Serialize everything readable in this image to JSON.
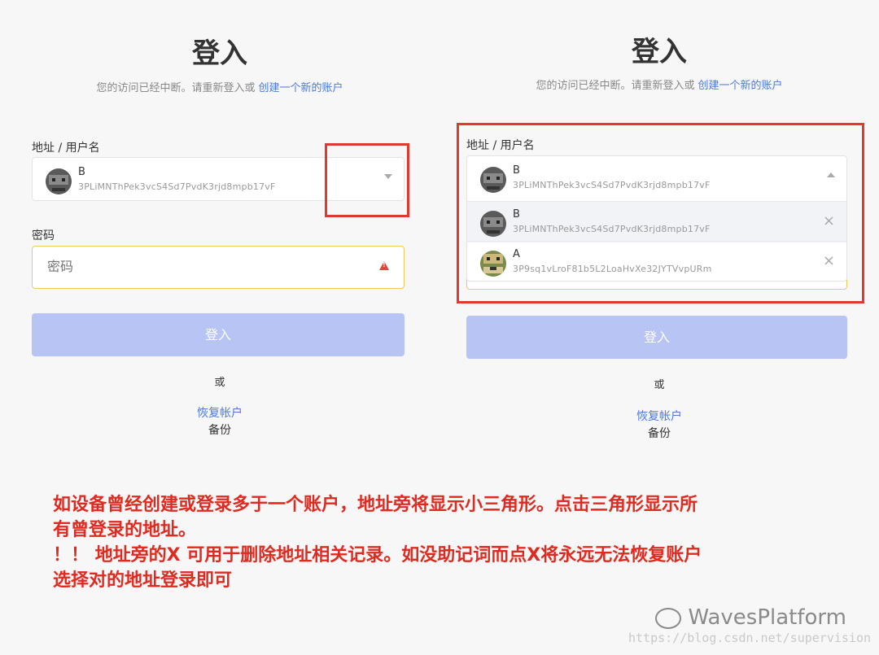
{
  "title": "登入",
  "subtitle": {
    "text": "您的访问已经中断。请重新登入或",
    "link": "创建一个新的账户"
  },
  "address_label": "地址 / 用户名",
  "password_label": "密码",
  "password_placeholder": "密码",
  "login_button": "登入",
  "or_text": "或",
  "restore_link": "恢复帐户",
  "backup_text": "备份",
  "accounts": [
    {
      "name": "B",
      "address": "3PLiMNThPek3vcS4Sd7PvdK3rjd8mpb17vF"
    },
    {
      "name": "A",
      "address": "3P9sq1vLroF81b5L2LoaHvXe32JYTVvpURm"
    }
  ],
  "dropdown_close_glyph": "×",
  "note": {
    "line1": "如设备曾经创建或登录多于一个账户，地址旁将显示小三角形。点击三角形显示所",
    "line2": "有曾登录的地址。",
    "line3": "！！ 地址旁的X 可用于删除地址相关记录。如没助记词而点X将永远无法恢复账户",
    "line4": "选择对的地址登录即可"
  },
  "watermark": {
    "brand": "WavesPlatform",
    "url": "https://blog.csdn.net/supervision"
  },
  "colors": {
    "accent": "#4a7bd8",
    "button": "#b8c4f4",
    "warning": "#e0443a",
    "highlight": "#e03a2f",
    "note": "#e02a20"
  }
}
